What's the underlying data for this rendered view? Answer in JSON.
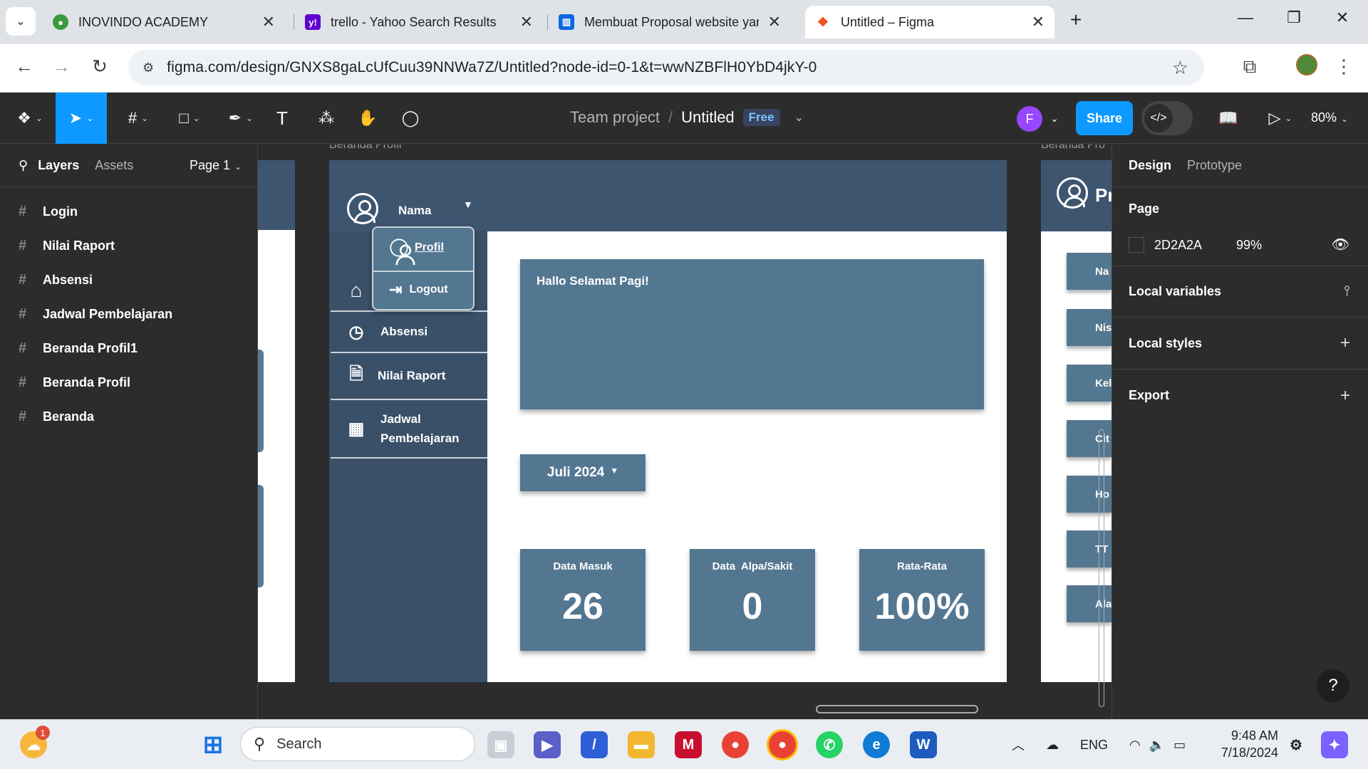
{
  "browser": {
    "tabs": [
      {
        "title": "INOVINDO ACADEMY",
        "active": false
      },
      {
        "title": "trello - Yahoo Search Results",
        "active": false
      },
      {
        "title": "Membuat Proposal website yan",
        "active": false
      },
      {
        "title": "Untitled – Figma",
        "active": true
      }
    ],
    "url": "figma.com/design/GNXS8gaLcUfCuu39NNWa7Z/Untitled?node-id=0-1&t=wwNZBFlH0YbD4jkY-0"
  },
  "figma": {
    "team": "Team project",
    "file_name": "Untitled",
    "plan_badge": "Free",
    "avatar_initial": "F",
    "share_label": "Share",
    "zoom": "80%",
    "left_panel": {
      "tab_layers": "Layers",
      "tab_assets": "Assets",
      "page_selector": "Page 1",
      "layers": [
        "Login",
        "Nilai Raport",
        "Absensi",
        "Jadwal Pembelajaran",
        "Beranda Profil1",
        "Beranda Profil",
        "Beranda"
      ]
    },
    "right_panel": {
      "tab_design": "Design",
      "tab_prototype": "Prototype",
      "page_heading": "Page",
      "page_color": "2D2A2A",
      "page_opacity": "99%",
      "local_variables": "Local variables",
      "local_styles": "Local styles",
      "export": "Export",
      "help": "?"
    }
  },
  "canvas": {
    "frame_label_main": "Beranda Profil",
    "frame_label_right": "Beranda Pro",
    "header": {
      "user_name": "Nama"
    },
    "dropdown": {
      "profil": "Profil",
      "logout": "Logout"
    },
    "sidebar": {
      "absensi": "Absensi",
      "nilai_raport": "Nilai Raport",
      "jadwal_line1": "Jadwal",
      "jadwal_line2": "Pembelajaran"
    },
    "greeting": "Hallo Selamat Pagi!",
    "month_selector": "Juli 2024",
    "stats": [
      {
        "label": "Data Masuk",
        "value": "26"
      },
      {
        "label": "Data  Alpa/Sakit",
        "value": "0"
      },
      {
        "label": "Rata-Rata",
        "value": "100%"
      }
    ],
    "right_frame": {
      "title": "Pr",
      "rows": [
        "Na",
        "Nis",
        "Kel",
        "Cit",
        "Ho",
        "TT",
        "Ala"
      ]
    }
  },
  "taskbar": {
    "search_placeholder": "Search",
    "language": "ENG",
    "time": "9:48 AM",
    "date": "7/18/2024",
    "notification_count": "1"
  },
  "colors": {
    "figma_accent": "#0d99ff",
    "frame_header": "#3e5570",
    "card": "#547791"
  }
}
